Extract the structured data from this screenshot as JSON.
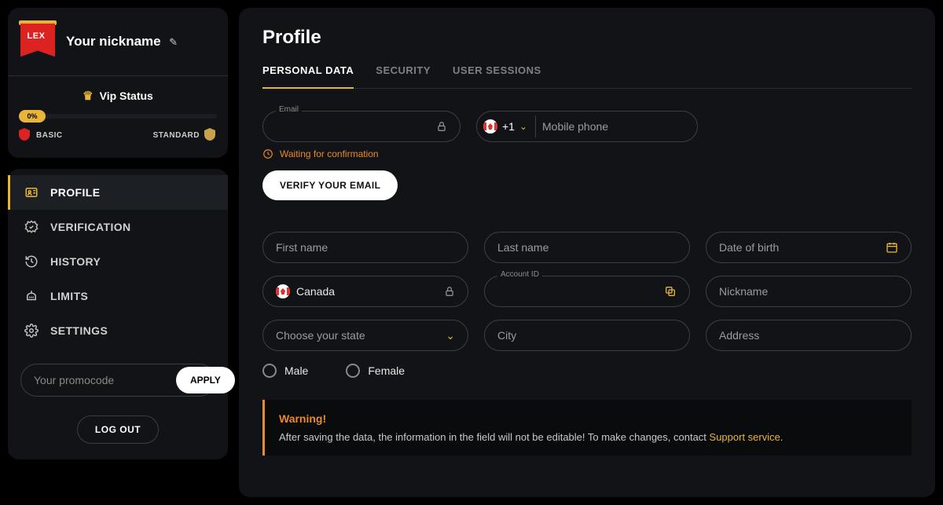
{
  "user": {
    "logo_text": "LEX",
    "nickname": "Your nickname"
  },
  "vip": {
    "label": "Vip Status",
    "progress_pct": "0%",
    "tier_low": "BASIC",
    "tier_high": "STANDARD"
  },
  "sidebar": {
    "items": [
      {
        "label": "PROFILE"
      },
      {
        "label": "VERIFICATION"
      },
      {
        "label": "HISTORY"
      },
      {
        "label": "LIMITS"
      },
      {
        "label": "SETTINGS"
      }
    ],
    "promo_placeholder": "Your promocode",
    "apply_label": "APPLY",
    "logout_label": "LOG OUT"
  },
  "page": {
    "title": "Profile",
    "tabs": [
      {
        "label": "PERSONAL DATA"
      },
      {
        "label": "SECURITY"
      },
      {
        "label": "USER SESSIONS"
      }
    ]
  },
  "form": {
    "email_label": "Email",
    "email_status": "Waiting for confirmation",
    "verify_btn": "VERIFY YOUR EMAIL",
    "phone_cc": "+1",
    "phone_placeholder": "Mobile phone",
    "first_name": "First name",
    "last_name": "Last name",
    "dob": "Date of birth",
    "country": "Canada",
    "account_id_label": "Account ID",
    "nickname_placeholder": "Nickname",
    "state_placeholder": "Choose your state",
    "city_placeholder": "City",
    "address_placeholder": "Address",
    "gender_male": "Male",
    "gender_female": "Female"
  },
  "warning": {
    "title": "Warning!",
    "body_pre": "After saving the data, the information in the field will not be editable! To make changes, contact ",
    "link": "Support service",
    "body_post": "."
  }
}
